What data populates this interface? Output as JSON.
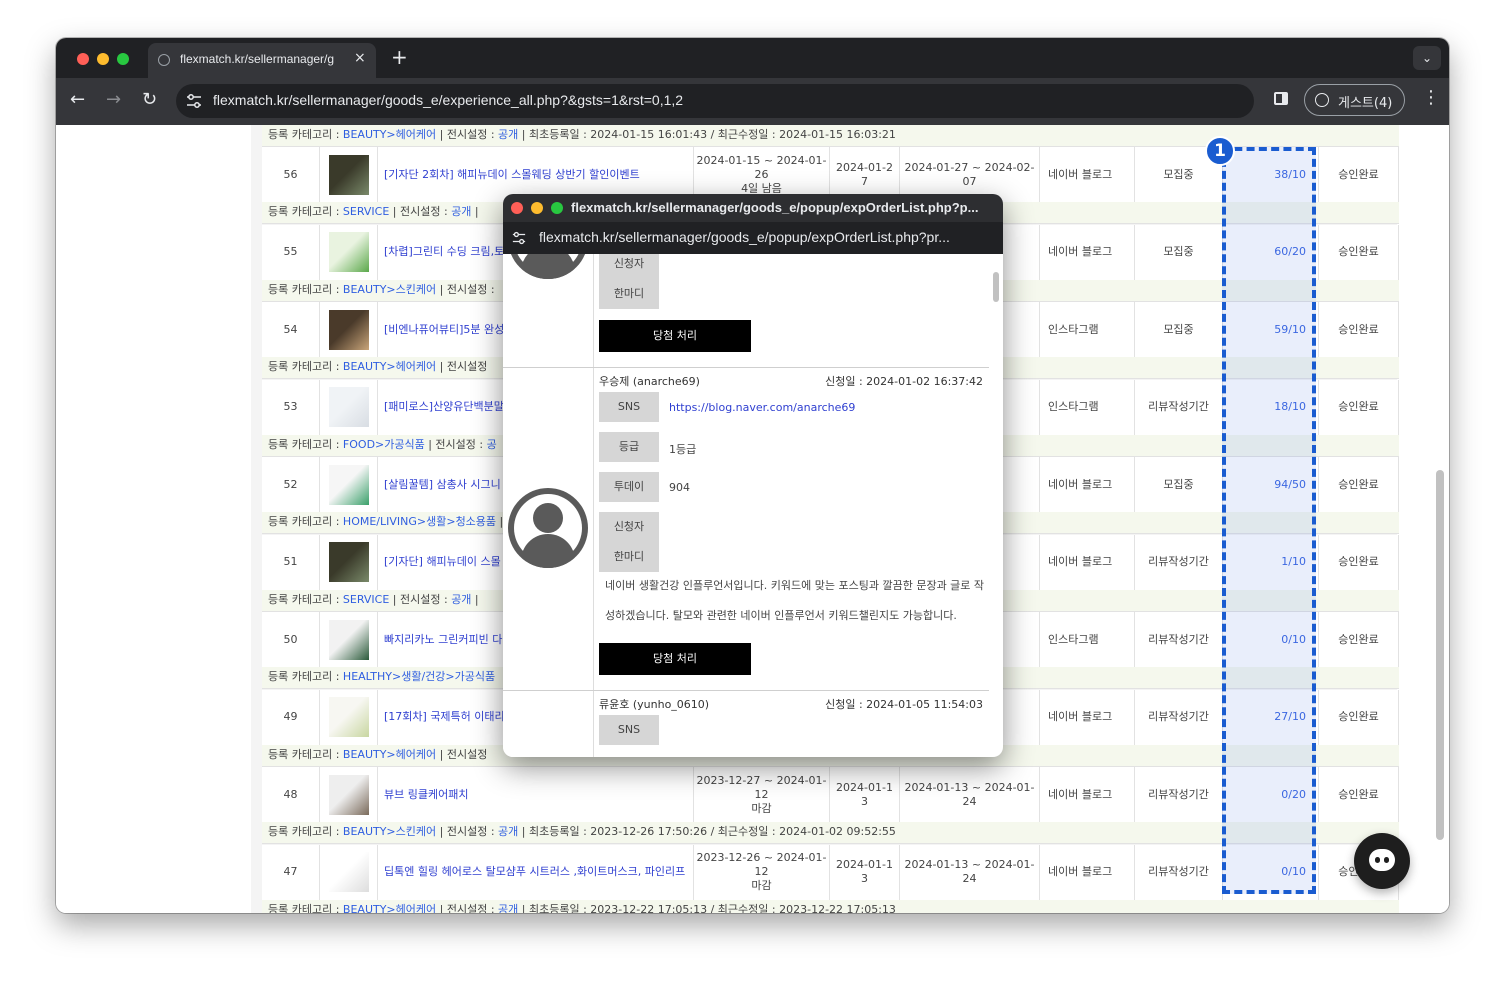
{
  "browser": {
    "tab_title": "flexmatch.kr/sellermanager/g",
    "url": "flexmatch.kr/sellermanager/goods_e/experience_all.php?&gsts=1&rst=0,1,2",
    "profile_label": "게스트(4)",
    "close_icon": "×",
    "new_tab_icon": "+",
    "menu_icon": "⌄",
    "back_icon": "←",
    "forward_icon": "→",
    "reload_icon": "↻",
    "kebab_icon": "⋮"
  },
  "list": {
    "top_category": {
      "prefix": "등록 카테고리 : ",
      "category": "BEAUTY>헤어케어",
      "sep1": "  |  전시설정 : ",
      "display": "공개",
      "sep2": "  |  최초등록일 : 2024-01-15 16:01:43 / 최근수정일 : 2024-01-15 16:03:21"
    },
    "items": [
      {
        "no": "56",
        "title": "[기자단 2회차] 해피뉴데이 스몰웨딩 상반기 할인이벤트",
        "period": "2024-01-15 ~ 2024-01-26\n4일 남음",
        "selection": "2024-01-2\n7",
        "review": "2024-01-27 ~ 2024-02-07",
        "channel": "네이버 블로그",
        "status": "모집중",
        "count": "38/10",
        "approval": "승인완료",
        "category": {
          "prefix": "등록 카테고리 : ",
          "category": "SERVICE",
          "sep1": "  |  전시설정 : ",
          "display": "공개",
          "sep2": "  |"
        }
      },
      {
        "no": "55",
        "title": "[차렵]그린티 수딩 크림,토너,",
        "period": "",
        "selection": "",
        "review": "4-02-",
        "channel": "네이버 블로그",
        "status": "모집중",
        "count": "60/20",
        "approval": "승인완료",
        "category": {
          "prefix": "등록 카테고리 : ",
          "category": "BEAUTY>스킨케어",
          "sep1": "  |  전시설정 :",
          "display": "",
          "sep2": ""
        }
      },
      {
        "no": "54",
        "title": "[비엔나퓨어뷰티]5분 완성",
        "period": "",
        "selection": "",
        "review": "4-02-",
        "channel": "인스타그램",
        "status": "모집중",
        "count": "59/10",
        "approval": "승인완료",
        "category": {
          "prefix": "등록 카테고리 : ",
          "category": "BEAUTY>헤어케어",
          "sep1": "  |  전시설정",
          "display": "",
          "sep2": ""
        }
      },
      {
        "no": "53",
        "title": "[패미로스]산양유단백분말",
        "period": "",
        "selection": "",
        "review": "4-02-",
        "channel": "인스타그램",
        "status": "리뷰작성기간",
        "count": "18/10",
        "approval": "승인완료",
        "category": {
          "prefix": "등록 카테고리 : ",
          "category": "FOOD>가공식품",
          "sep1": "  |  전시설정 : ",
          "display": "공",
          "sep2": ""
        }
      },
      {
        "no": "52",
        "title": "[살림꿀템] 삼총사 시그니",
        "period": "",
        "selection": "",
        "review": "4-02-",
        "channel": "네이버 블로그",
        "status": "모집중",
        "count": "94/50",
        "approval": "승인완료",
        "category": {
          "prefix": "등록 카테고리 : ",
          "category": "HOME/LIVING>생활>청소용품",
          "sep1": "  |",
          "display": "",
          "sep2": ""
        }
      },
      {
        "no": "51",
        "title": "[기자단] 해피뉴데이 스몰",
        "period": "",
        "selection": "",
        "review": "4-01-",
        "channel": "네이버 블로그",
        "status": "리뷰작성기간",
        "count": "1/10",
        "approval": "승인완료",
        "category": {
          "prefix": "등록 카테고리 : ",
          "category": "SERVICE",
          "sep1": "  |  전시설정 : ",
          "display": "공개",
          "sep2": "  |"
        }
      },
      {
        "no": "50",
        "title": "빠지리카노 그린커피빈 다",
        "period": "",
        "selection": "",
        "review": "4-01-",
        "channel": "인스타그램",
        "status": "리뷰작성기간",
        "count": "0/10",
        "approval": "승인완료",
        "category": {
          "prefix": "등록 카테고리 : ",
          "category": "HEALTHY>생활/건강>가공식품",
          "sep1": "",
          "display": "",
          "sep2": ""
        }
      },
      {
        "no": "49",
        "title": "[17회차] 국제특허 이태리",
        "period": "",
        "selection": "",
        "review": "4-01-",
        "channel": "네이버 블로그",
        "status": "리뷰작성기간",
        "count": "27/10",
        "approval": "승인완료",
        "category": {
          "prefix": "등록 카테고리 : ",
          "category": "BEAUTY>헤어케어",
          "sep1": "  |  전시설정",
          "display": "",
          "sep2": ""
        }
      },
      {
        "no": "48",
        "title": "뷰브 링클케어패치",
        "period": "2023-12-27 ~ 2024-01-12\n마감",
        "selection": "2024-01-1\n3",
        "review": "2024-01-13 ~ 2024-01-24",
        "channel": "네이버 블로그",
        "status": "리뷰작성기간",
        "count": "0/20",
        "approval": "승인완료",
        "category": {
          "prefix": "등록 카테고리 : ",
          "category": "BEAUTY>스킨케어",
          "sep1": "  |  전시설정 : ",
          "display": "공개",
          "sep2": "  |  최초등록일 : 2023-12-26 17:50:26 / 최근수정일 : 2024-01-02 09:52:55"
        }
      },
      {
        "no": "47",
        "title": "딥톡엔 힐링 헤어로스 탈모샴푸 시트러스 ,화이트머스크, 파인리프",
        "period": "2023-12-26 ~ 2024-01-12\n마감",
        "selection": "2024-01-1\n3",
        "review": "2024-01-13 ~ 2024-01-24",
        "channel": "네이버 블로그",
        "status": "리뷰작성기간",
        "count": "0/10",
        "approval": "승인완료",
        "category": {
          "prefix": "등록 카테고리 : ",
          "category": "BEAUTY>헤어케어",
          "sep1": "  |  전시설정 : ",
          "display": "공개",
          "sep2": "  |  최초등록일 : 2023-12-22 17:05:13 / 최근수정일 : 2023-12-22 17:05:13"
        }
      }
    ],
    "annotation_badge": "1"
  },
  "popup": {
    "title": "flexmatch.kr/sellermanager/goods_e/popup/expOrderList.php?p...",
    "url": "flexmatch.kr/sellermanager/goods_e/popup/expOrderList.php?pr...",
    "labels": {
      "sns": "SNS",
      "grade": "등급",
      "today": "투데이",
      "applicant": "신청자",
      "comment": "한마디"
    },
    "select_button": "당첨 처리",
    "applicants": [
      {
        "name": "우승제 (anarche69)",
        "date": "신청일 : 2024-01-02 16:37:42",
        "sns": "https://blog.naver.com/anarche69",
        "grade": "1등급",
        "today": "904",
        "comment": "네이버 생활건강 인플루언서입니다. 키워드에 맞는 포스팅과 깔끔한 문장과 글로 작성하겠습니다. 탈모와 관련한 네이버 인플루언서 키워드챌린지도 가능합니다."
      },
      {
        "name": "류윤호 (yunho_0610)",
        "date": "신청일 : 2024-01-05 11:54:03"
      }
    ]
  }
}
